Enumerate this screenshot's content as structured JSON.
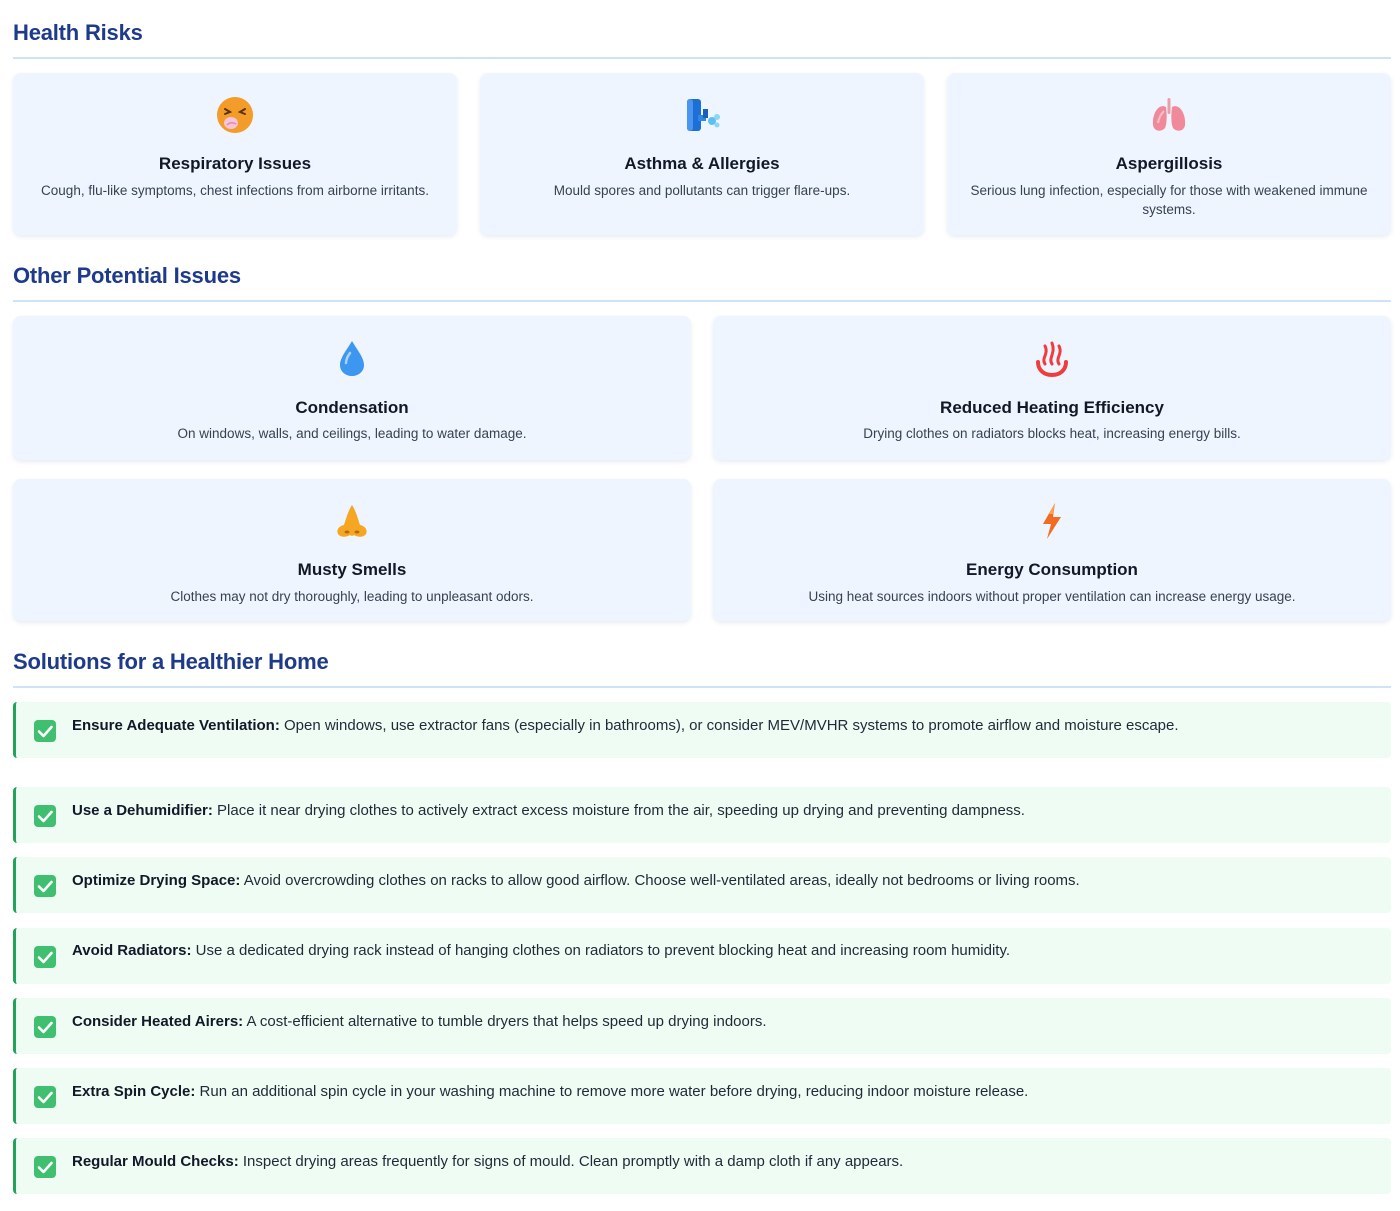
{
  "health": {
    "title": "Health Risks",
    "cards": [
      {
        "icon": "sneezing-face-icon",
        "title": "Respiratory Issues",
        "desc": "Cough, flu-like symptoms, chest infections from airborne irritants."
      },
      {
        "icon": "inhaler-icon",
        "title": "Asthma & Allergies",
        "desc": "Mould spores and pollutants can trigger flare-ups."
      },
      {
        "icon": "lungs-icon",
        "title": "Aspergillosis",
        "desc": "Serious lung infection, especially for those with weakened immune systems."
      }
    ]
  },
  "other": {
    "title": "Other Potential Issues",
    "cards": [
      {
        "icon": "water-droplet-icon",
        "title": "Condensation",
        "desc": "On windows, walls, and ceilings, leading to water damage."
      },
      {
        "icon": "heat-icon",
        "title": "Reduced Heating Efficiency",
        "desc": "Drying clothes on radiators blocks heat, increasing energy bills."
      },
      {
        "icon": "nose-icon",
        "title": "Musty Smells",
        "desc": "Clothes may not dry thoroughly, leading to unpleasant odors."
      },
      {
        "icon": "lightning-icon",
        "title": "Energy Consumption",
        "desc": "Using heat sources indoors without proper ventilation can increase energy usage."
      }
    ]
  },
  "solutions": {
    "title": "Solutions for a Healthier Home",
    "items": [
      {
        "label": "Ensure Adequate Ventilation:",
        "text": " Open windows, use extractor fans (especially in bathrooms), or consider MEV/MVHR systems to promote airflow and moisture escape."
      },
      {
        "label": "Use a Dehumidifier:",
        "text": " Place it near drying clothes to actively extract excess moisture from the air, speeding up drying and preventing dampness."
      },
      {
        "label": "Optimize Drying Space:",
        "text": " Avoid overcrowding clothes on racks to allow good airflow. Choose well-ventilated areas, ideally not bedrooms or living rooms."
      },
      {
        "label": "Avoid Radiators:",
        "text": " Use a dedicated drying rack instead of hanging clothes on radiators to prevent blocking heat and increasing room humidity."
      },
      {
        "label": "Consider Heated Airers:",
        "text": " A cost-efficient alternative to tumble dryers that helps speed up drying indoors."
      },
      {
        "label": "Extra Spin Cycle:",
        "text": " Run an additional spin cycle in your washing machine to remove more water before drying, reducing indoor moisture release."
      },
      {
        "label": "Regular Mould Checks:",
        "text": " Inspect drying areas frequently for signs of mould. Clean promptly with a damp cloth if any appears."
      }
    ]
  },
  "colors": {
    "heading": "#1e3a8a",
    "card_bg": "#eef5ff",
    "solution_bg": "#effcf3",
    "solution_accent": "#22a35a",
    "check": "#3fbf6f"
  }
}
